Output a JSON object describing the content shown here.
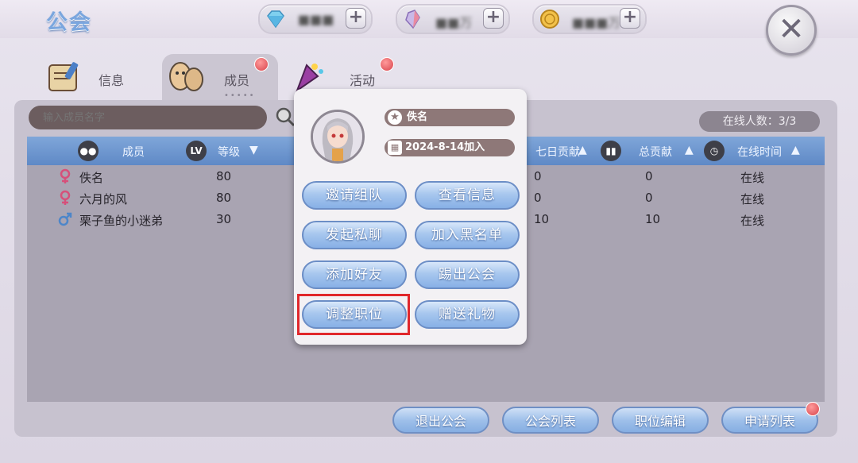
{
  "header": {
    "title": "公会",
    "currencies": [
      {
        "icon": "diamond-icon",
        "value": "■■■"
      },
      {
        "icon": "crystal-icon",
        "value": "■■万"
      },
      {
        "icon": "gold-coin-icon",
        "value": "■■■万"
      }
    ]
  },
  "tabs": [
    {
      "label": "信息",
      "icon": "scroll-icon"
    },
    {
      "label": "成员",
      "icon": "members-icon",
      "active": true
    },
    {
      "label": "活动",
      "icon": "party-icon"
    }
  ],
  "tab_dots": "•••••",
  "search": {
    "placeholder": "输入成员名字"
  },
  "online_count": "在线人数：3/3",
  "table": {
    "headers": {
      "member": "成员",
      "lv_badge": "LV",
      "level": "等级",
      "seven_day": "七日贡献",
      "total": "总贡献",
      "online_time": "在线时间"
    },
    "rows": [
      {
        "gender": "female",
        "name": "佚名",
        "level": "80",
        "seven_day": "0",
        "total": "0",
        "online": "在线"
      },
      {
        "gender": "female",
        "name": "六月的风",
        "level": "80",
        "seven_day": "0",
        "total": "0",
        "online": "在线"
      },
      {
        "gender": "male",
        "name": "栗子鱼的小迷弟",
        "level": "30",
        "seven_day": "10",
        "total": "10",
        "online": "在线"
      }
    ]
  },
  "popup": {
    "name": "佚名",
    "joined": "2024-8-14加入",
    "buttons": {
      "invite": "邀请组队",
      "view": "查看信息",
      "chat": "发起私聊",
      "blacklist": "加入黑名单",
      "add_friend": "添加好友",
      "kick": "踢出公会",
      "adjust_role": "调整职位",
      "gift": "赠送礼物"
    }
  },
  "bottom": {
    "leave": "退出公会",
    "list": "公会列表",
    "role_edit": "职位编辑",
    "apply": "申请列表"
  },
  "colors": {
    "accent": "#e0272b",
    "button_blue": "#87b0e6",
    "table_header": "#6f97cf"
  }
}
